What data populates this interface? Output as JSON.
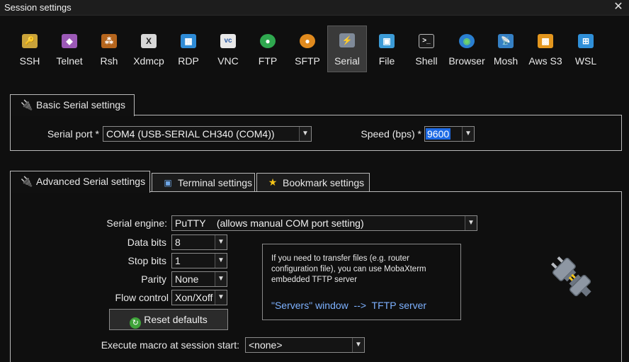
{
  "window": {
    "title": "Session settings",
    "close_glyph": "✕"
  },
  "toolbar": {
    "items": [
      {
        "label": "SSH",
        "icon": "key-icon",
        "glyph": "🔑",
        "color": "#caa33a"
      },
      {
        "label": "Telnet",
        "icon": "telnet-icon",
        "glyph": "◆",
        "color": "#9b59b6"
      },
      {
        "label": "Rsh",
        "icon": "rsh-icon",
        "glyph": "⁂",
        "color": "#b5651d"
      },
      {
        "label": "Xdmcp",
        "icon": "xdmcp-icon",
        "glyph": "X",
        "color": "#6b6b6b"
      },
      {
        "label": "RDP",
        "icon": "rdp-icon",
        "glyph": "▦",
        "color": "#2e8bd6"
      },
      {
        "label": "VNC",
        "icon": "vnc-icon",
        "glyph": "vc",
        "color": "#4a78b8"
      },
      {
        "label": "FTP",
        "icon": "ftp-icon",
        "glyph": "●",
        "color": "#2fa84f"
      },
      {
        "label": "SFTP",
        "icon": "sftp-icon",
        "glyph": "●",
        "color": "#e08a1e"
      },
      {
        "label": "Serial",
        "icon": "serial-plug-icon",
        "glyph": "⚡",
        "color": "#7f8a99"
      },
      {
        "label": "File",
        "icon": "file-icon",
        "glyph": "▣",
        "color": "#3c9bd6"
      },
      {
        "label": "Shell",
        "icon": "shell-icon",
        "glyph": ">_",
        "color": "#2a2a2a"
      },
      {
        "label": "Browser",
        "icon": "globe-icon",
        "glyph": "◉",
        "color": "#2a7fd0"
      },
      {
        "label": "Mosh",
        "icon": "mosh-icon",
        "glyph": "📡",
        "color": "#3580c4"
      },
      {
        "label": "Aws S3",
        "icon": "aws-s3-icon",
        "glyph": "▩",
        "color": "#e3961e"
      },
      {
        "label": "WSL",
        "icon": "wsl-icon",
        "glyph": "⊞",
        "color": "#2f8fd8"
      }
    ],
    "active": "Serial"
  },
  "basic": {
    "tab_label": "Basic Serial settings",
    "serial_port_label": "Serial port *",
    "serial_port_value": "COM4  (USB-SERIAL CH340 (COM4))",
    "speed_label": "Speed (bps) *",
    "speed_value": "9600"
  },
  "advanced": {
    "tabs": [
      "Advanced Serial settings",
      "Terminal settings",
      "Bookmark settings"
    ],
    "serial_engine_label": "Serial engine:",
    "serial_engine_value": "PuTTY    (allows manual COM port setting)",
    "data_bits_label": "Data bits",
    "data_bits_value": "8",
    "stop_bits_label": "Stop bits",
    "stop_bits_value": "1",
    "parity_label": "Parity",
    "parity_value": "None",
    "flow_label": "Flow control",
    "flow_value": "Xon/Xoff",
    "reset_label": "Reset defaults",
    "info_text": "If you need to transfer files (e.g. router configuration file), you can use MobaXterm embedded TFTP server",
    "info_link": "\"Servers\" window  -->  TFTP server",
    "macro_label": "Execute macro at session start:",
    "macro_value": "<none>"
  },
  "colors": {
    "accent": "#1d6ae5",
    "link": "#7db1ff"
  }
}
